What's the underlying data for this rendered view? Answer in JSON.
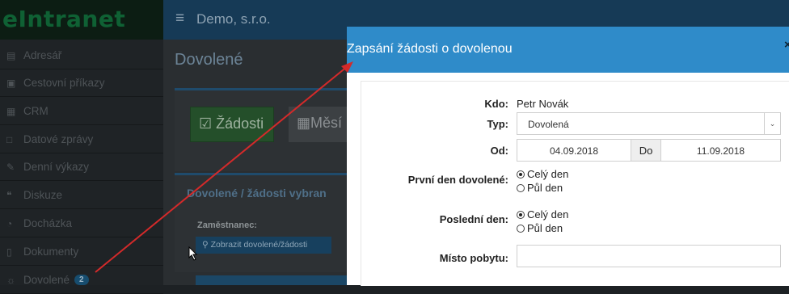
{
  "brand": "eIntranet",
  "sidebar": {
    "items": [
      {
        "label": "Adresář",
        "icon": "book-icon"
      },
      {
        "label": "Cestovní příkazy",
        "icon": "briefcase-icon"
      },
      {
        "label": "CRM",
        "icon": "building-icon"
      },
      {
        "label": "Datové zprávy",
        "icon": "inbox-icon"
      },
      {
        "label": "Denní výkazy",
        "icon": "pencil-icon"
      },
      {
        "label": "Diskuze",
        "icon": "comments-icon"
      },
      {
        "label": "Docházka",
        "icon": "clock-icon"
      },
      {
        "label": "Dokumenty",
        "icon": "file-icon"
      },
      {
        "label": "Dovolené",
        "icon": "sun-icon",
        "badge": "2"
      }
    ]
  },
  "topbar": {
    "menu_icon": "≡",
    "company": "Demo, s.r.o."
  },
  "page": {
    "title": "Dovolené",
    "tab_requests": "Žádosti",
    "tab_month": "Měsí",
    "box_title": "Dovolené / žádosti vybran",
    "employee_label": "Zaměstnanec:",
    "show_button": "Zobrazit dovolené/žádosti"
  },
  "modal": {
    "title": "Zapsání žádosti o dovolenou",
    "close": "×",
    "fields": {
      "kdo_label": "Kdo:",
      "kdo_value": "Petr Novák",
      "typ_label": "Typ:",
      "typ_value": "Dovolená",
      "od_label": "Od:",
      "od_value": "04.09.2018",
      "do_label": "Do",
      "do_value": "11.09.2018",
      "first_day_label": "První den dovolené:",
      "last_day_label": "Poslední den:",
      "option_full": "Celý den",
      "option_half": "Půl den",
      "place_label": "Místo pobytu:",
      "place_value": ""
    }
  },
  "colors": {
    "modal_header": "#2f8bc9",
    "topbar": "#163a56",
    "sidebar": "#1f2326",
    "arrow": "#d42a2a"
  }
}
